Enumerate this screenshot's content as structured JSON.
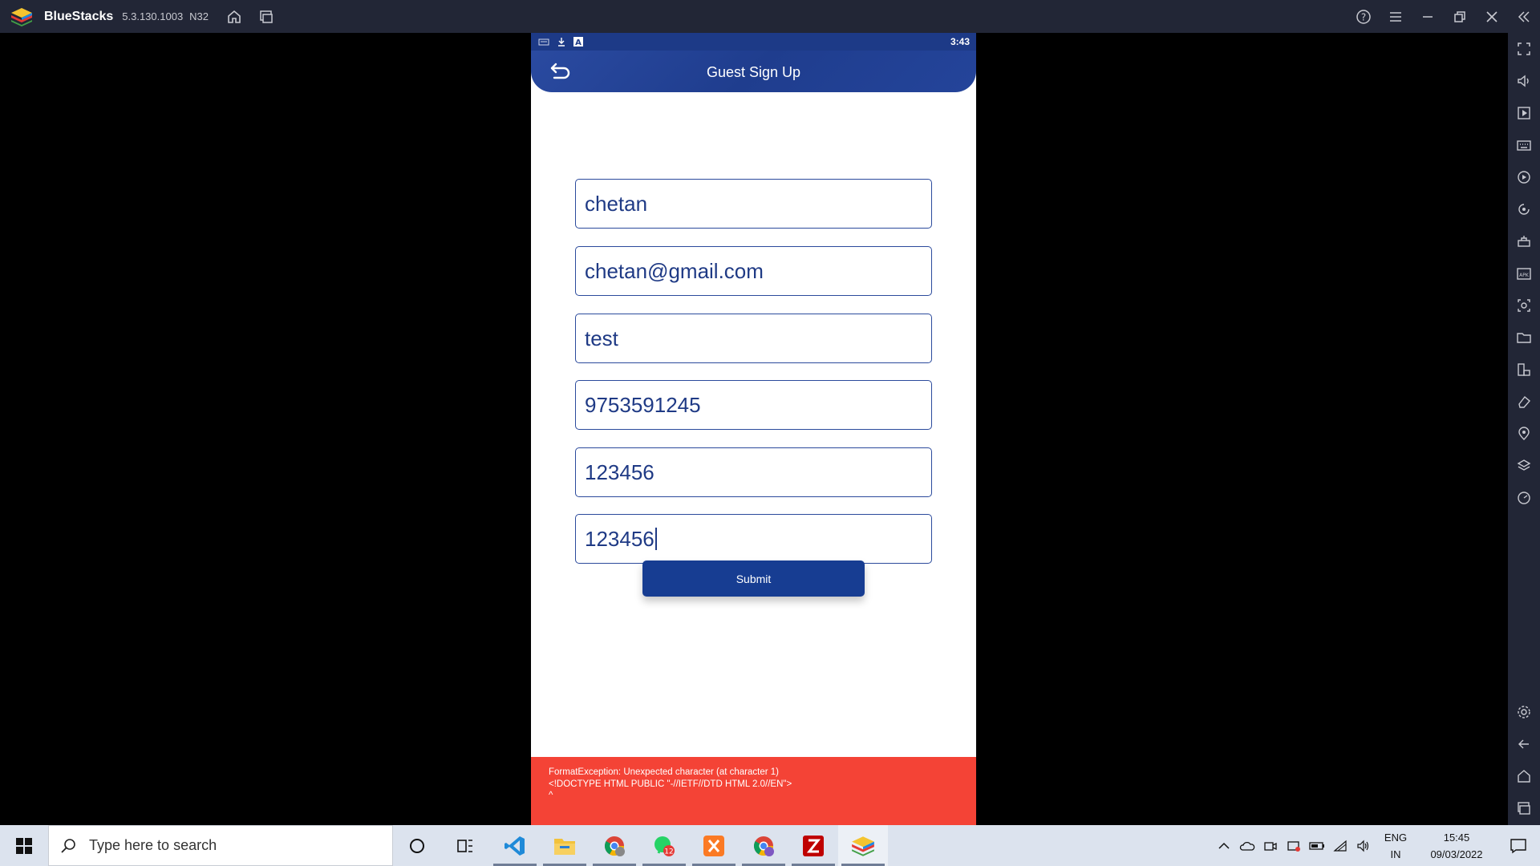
{
  "window": {
    "app_name": "BlueStacks",
    "version": "5.3.130.1003",
    "build_tag": "N32"
  },
  "device": {
    "status_time": "3:43"
  },
  "app": {
    "title": "Guest Sign Up",
    "fields": [
      {
        "name": "name",
        "value": "chetan"
      },
      {
        "name": "email",
        "value": "chetan@gmail.com"
      },
      {
        "name": "company",
        "value": "test"
      },
      {
        "name": "phone",
        "value": "9753591245"
      },
      {
        "name": "password",
        "value": "123456"
      },
      {
        "name": "confirm-password",
        "value": "123456"
      }
    ],
    "submit_label": "Submit",
    "error": {
      "line1": "FormatException: Unexpected character (at character 1)",
      "line2": "<!DOCTYPE HTML PUBLIC \"-//IETF//DTD HTML 2.0//EN\">",
      "line3": "^"
    }
  },
  "taskbar": {
    "search_placeholder": "Type here to search",
    "whatsapp_badge": "12",
    "lang_top": "ENG",
    "lang_bottom": "IN",
    "time": "15:45",
    "date": "09/03/2022"
  },
  "colors": {
    "brand_blue": "#1d3a87",
    "error_red": "#f44336",
    "titlebar": "#222636"
  }
}
